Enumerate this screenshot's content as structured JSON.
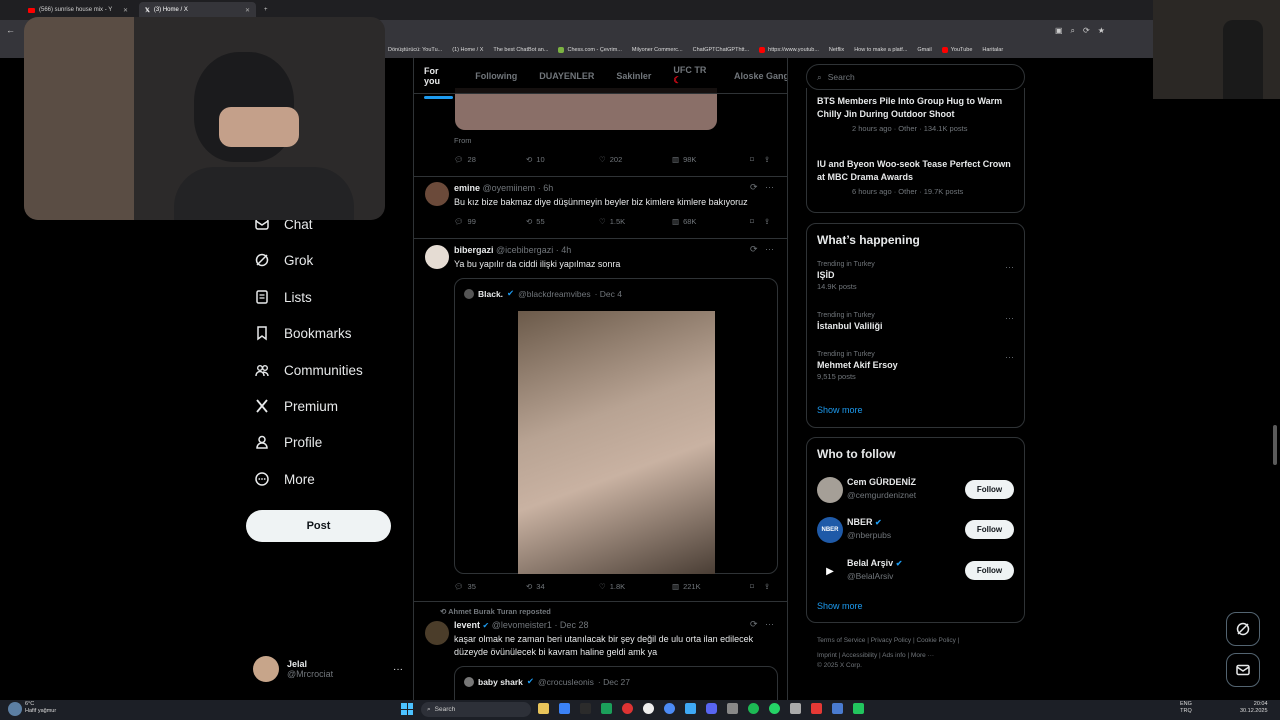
{
  "browser": {
    "tabs": [
      {
        "label": "(566) sunrise house mix - Y"
      },
      {
        "label": "(3) Home / X"
      }
    ],
    "bookmarks": [
      "Dönüştürücü: YouTu...",
      "(1) Home / X",
      "The best ChatBot an...",
      "Chess.com - Çevrim...",
      "Milyoner Commerc...",
      "ChatGPTChatGPThtt...",
      "https://www.youtub...",
      "Netflix",
      "How to make a platf...",
      "Gmail",
      "YouTube",
      "Haritalar"
    ]
  },
  "nav": {
    "items": [
      {
        "label": "Chat"
      },
      {
        "label": "Grok"
      },
      {
        "label": "Lists"
      },
      {
        "label": "Bookmarks"
      },
      {
        "label": "Communities"
      },
      {
        "label": "Premium"
      },
      {
        "label": "Profile"
      },
      {
        "label": "More"
      }
    ],
    "post_label": "Post",
    "account": {
      "name": "Jelal",
      "handle": "@Mrcrociat"
    }
  },
  "feed": {
    "tabs": [
      "For you",
      "Following",
      "DUAYENLER",
      "Sakinler",
      "UFC TR",
      "Aloske Gang"
    ],
    "tweet0": {
      "from": "From",
      "replies": "28",
      "reposts": "10",
      "likes": "202",
      "views": "98K"
    },
    "tweet1": {
      "name": "emine",
      "handle": "@oyemiinem",
      "time": "· 6h",
      "text": "Bu kız bize bakmaz diye düşünmeyin beyler biz kimlere kimlere bakıyoruz",
      "replies": "99",
      "reposts": "55",
      "likes": "1.5K",
      "views": "68K"
    },
    "tweet2": {
      "name": "bibergazi",
      "handle": "@icebibergazi",
      "time": "· 4h",
      "text": "Ya bu yapılır da ciddi ilişki yapılmaz sonra",
      "quote_name": "Black.",
      "quote_handle": "@blackdreamvibes",
      "quote_time": "· Dec 4",
      "replies": "35",
      "reposts": "34",
      "likes": "1.8K",
      "views": "221K"
    },
    "tweet3": {
      "reposted_by": "Ahmet Burak Turan reposted",
      "name": "levent",
      "handle": "@levomeister1",
      "time": "· Dec 28",
      "text": "kaşar olmak ne zaman beri utanılacak bir şey değil de ulu orta ilan edilecek düzeyde övünülecek bi kavram haline geldi amk ya",
      "quote_name": "baby shark",
      "quote_handle": "@crocusleonis",
      "quote_time": "· Dec 27"
    }
  },
  "sidebar": {
    "search_placeholder": "Search",
    "news": [
      {
        "title": "BTS Members Pile Into Group Hug to Warm Chilly Jin During Outdoor Shoot",
        "meta": "2 hours ago · Other · 134.1K posts"
      },
      {
        "title": "IU and Byeon Woo-seok Tease Perfect Crown at MBC Drama Awards",
        "meta": "6 hours ago · Other · 19.7K posts"
      }
    ],
    "happening_title": "What’s happening",
    "trends": [
      {
        "category": "Trending in Turkey",
        "name": "IŞİD",
        "posts": "14.9K posts"
      },
      {
        "category": "Trending in Turkey",
        "name": "İstanbul Valiliği",
        "posts": ""
      },
      {
        "category": "Trending in Turkey",
        "name": "Mehmet Akif Ersoy",
        "posts": "9,515 posts"
      }
    ],
    "show_more": "Show more",
    "who_title": "Who to follow",
    "follow": [
      {
        "name": "Cem GÜRDENİZ",
        "handle": "@cemgurdeniznet",
        "button": "Follow"
      },
      {
        "name": "NBER",
        "handle": "@nberpubs",
        "button": "Follow"
      },
      {
        "name": "Belal Arşiv",
        "handle": "@BelalArsiv",
        "button": "Follow"
      }
    ],
    "show_more2": "Show more",
    "footer": {
      "line1": "Terms of Service  |  Privacy Policy  |  Cookie Policy  |",
      "line2": "Imprint  |  Accessibility  |  Ads info  |  More ···",
      "line3": "© 2025 X Corp."
    }
  },
  "taskbar": {
    "weather_temp": "6°C",
    "weather_desc": "Hafif yağmur",
    "search": "Search",
    "lang": "ENG",
    "region": "TRQ",
    "time": "20:04",
    "date": "30.12.2025"
  },
  "colors": {
    "accent": "#1d9bf0",
    "bg": "#000000",
    "border": "#2f3336",
    "muted": "#71767b"
  }
}
